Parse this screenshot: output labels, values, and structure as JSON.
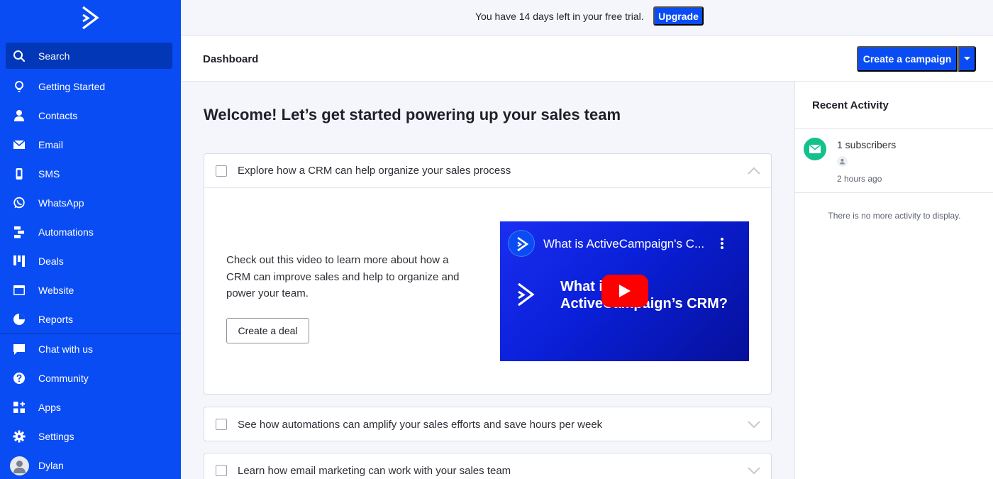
{
  "sidebar": {
    "items": [
      {
        "label": "Search",
        "icon": "search-icon"
      },
      {
        "label": "Getting Started",
        "icon": "lightbulb-icon"
      },
      {
        "label": "Contacts",
        "icon": "person-icon"
      },
      {
        "label": "Email",
        "icon": "envelope-icon"
      },
      {
        "label": "SMS",
        "icon": "phone-icon"
      },
      {
        "label": "WhatsApp",
        "icon": "whatsapp-icon"
      },
      {
        "label": "Automations",
        "icon": "automation-icon"
      },
      {
        "label": "Deals",
        "icon": "pipeline-icon"
      },
      {
        "label": "Website",
        "icon": "browser-icon"
      },
      {
        "label": "Reports",
        "icon": "pie-chart-icon"
      }
    ],
    "bottom_items": [
      {
        "label": "Chat with us",
        "icon": "chat-icon"
      },
      {
        "label": "Community",
        "icon": "help-icon"
      },
      {
        "label": "Apps",
        "icon": "apps-icon"
      },
      {
        "label": "Settings",
        "icon": "gear-icon"
      },
      {
        "label": "Dylan",
        "icon": "avatar-icon"
      }
    ]
  },
  "banner": {
    "text": "You have 14 days left in your free trial.",
    "upgrade_label": "Upgrade"
  },
  "header": {
    "title": "Dashboard",
    "create_label": "Create a campaign"
  },
  "main": {
    "welcome": "Welcome! Let’s get started powering up your sales team",
    "cards": [
      {
        "title": "Explore how a CRM can help organize your sales process",
        "body": "Check out this video to learn more about how a CRM can improve sales and help to organize and power your team.",
        "button_label": "Create a deal",
        "video_title": "What is ActiveCampaign's C...",
        "video_line1": "What is",
        "video_line2": "ActiveCampaign’s CRM?"
      },
      {
        "title": "See how automations can amplify your sales efforts and save hours per week"
      },
      {
        "title": "Learn how email marketing can work with your sales team"
      }
    ]
  },
  "recent_activity": {
    "title": "Recent Activity",
    "item_text": "1 subscribers",
    "item_time": "2 hours ago",
    "empty_text": "There is no more activity to display."
  },
  "colors": {
    "brand": "#0a4cf4",
    "sidebar_active": "#0237b8",
    "activity_green": "#14c08b",
    "play_red": "#ff0000"
  }
}
